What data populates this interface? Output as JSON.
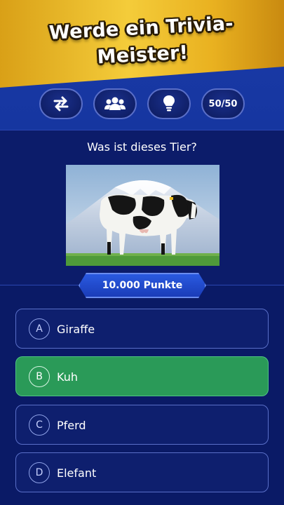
{
  "header": {
    "title_line1": "Werde ein Trivia-",
    "title_line2": "Meister!"
  },
  "lifelines": [
    {
      "name": "swap-question",
      "icon": "swap-arrows-icon",
      "label": ""
    },
    {
      "name": "ask-audience",
      "icon": "people-group-icon",
      "label": ""
    },
    {
      "name": "hint",
      "icon": "lightbulb-icon",
      "label": ""
    },
    {
      "name": "fifty-fifty",
      "icon": "",
      "label": "50/50"
    }
  ],
  "question": {
    "text": "Was ist dieses Tier?",
    "image": "cow-photo-with-mountain"
  },
  "points": {
    "label": "10.000 Punkte"
  },
  "answers": [
    {
      "letter": "A",
      "label": "Giraffe",
      "state": "default"
    },
    {
      "letter": "B",
      "label": "Kuh",
      "state": "correct"
    },
    {
      "letter": "C",
      "label": "Pferd",
      "state": "default"
    },
    {
      "letter": "D",
      "label": "Elefant",
      "state": "default"
    }
  ],
  "colors": {
    "background": "#0a1a66",
    "banner_gold": "#f4cc3a",
    "correct_green": "#2a9a58",
    "border_blue": "#5a6fc8"
  }
}
